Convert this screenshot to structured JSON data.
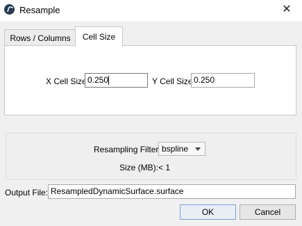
{
  "window": {
    "title": "Resample"
  },
  "tabs": [
    {
      "label": "Rows / Columns",
      "active": false
    },
    {
      "label": "Cell Size",
      "active": true
    }
  ],
  "cell_size": {
    "x_label": "X Cell Size",
    "x_value": "0.250",
    "y_label": "Y Cell Size",
    "y_value": "0.250"
  },
  "resampling": {
    "filter_label": "Resampling Filter:",
    "filter_value": "bspline",
    "size_label": "Size (MB):",
    "size_value": "< 1"
  },
  "output": {
    "label": "Output File:",
    "value": "ResampledDynamicSurface.surface"
  },
  "buttons": {
    "ok": "OK",
    "cancel": "Cancel"
  },
  "icons": {
    "app": "app-logo-icon",
    "close": "close-icon",
    "dropdown": "chevron-down-icon"
  }
}
